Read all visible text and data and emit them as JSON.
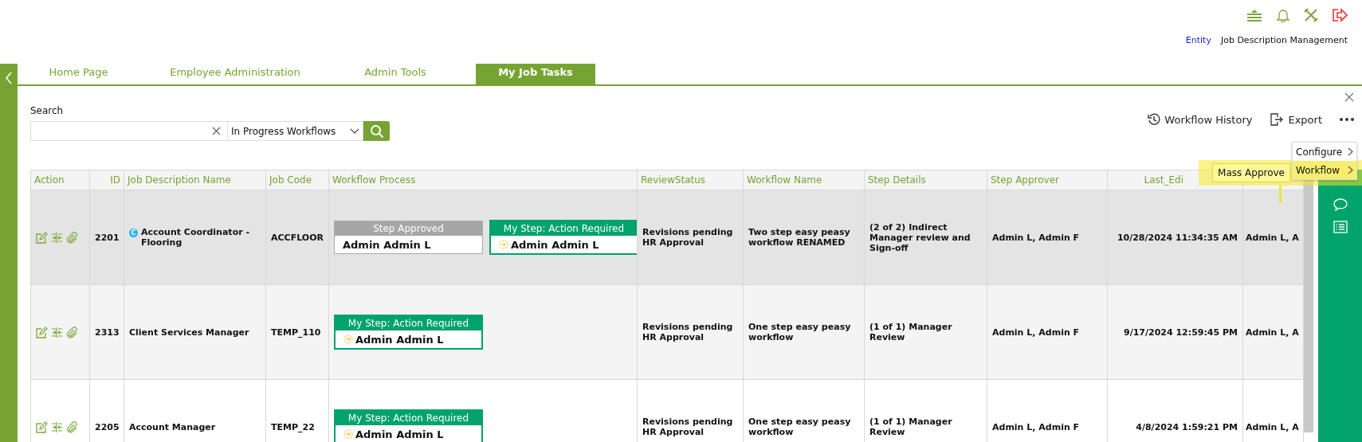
{
  "header": {
    "entity_link": "Entity",
    "module": "Job Description Management"
  },
  "tabs": [
    {
      "label": "Home Page",
      "selected": false
    },
    {
      "label": "Employee Administration",
      "selected": false
    },
    {
      "label": "Admin Tools",
      "selected": false
    },
    {
      "label": "My Job Tasks",
      "selected": true
    }
  ],
  "search": {
    "label": "Search",
    "filter": "In Progress Workflows"
  },
  "toolbar": {
    "history": "Workflow History",
    "export": "Export"
  },
  "menu": {
    "items": [
      {
        "label": "Configure",
        "highlighted": false
      },
      {
        "label": "Workflow",
        "highlighted": true
      }
    ],
    "submenu": "Mass Approve"
  },
  "table": {
    "columns": [
      "Action",
      "ID",
      "Job Description Name",
      "Job Code",
      "Workflow Process",
      "ReviewStatus",
      "Workflow Name",
      "Step Details",
      "Step Approver",
      "Last_Edi",
      ""
    ],
    "rows": [
      {
        "selected": true,
        "id": "2201",
        "badge": "C",
        "name": "Account Coordinator - Flooring",
        "code": "ACCFLOOR",
        "steps": [
          {
            "kind": "approved",
            "title": "Step Approved",
            "approver": "Admin Admin L"
          },
          {
            "kind": "pending",
            "title": "My Step: Action Required",
            "approver": "Admin Admin L"
          }
        ],
        "review_status": "Revisions pending HR Approval",
        "workflow_name": "Two step easy peasy workflow RENAMED",
        "step_details": "(2 of 2) Indirect Manager review and Sign-off",
        "step_approver": "Admin L, Admin F",
        "last_edited": "10/28/2024 11:34:35 AM",
        "column_11": "Admin L, A"
      },
      {
        "selected": false,
        "id": "2313",
        "name": "Client Services Manager",
        "code": "TEMP_110",
        "steps": [
          {
            "kind": "pending",
            "title": "My Step: Action Required",
            "approver": "Admin Admin L"
          }
        ],
        "review_status": "Revisions pending HR Approval",
        "workflow_name": "One step easy peasy workflow",
        "step_details": "(1 of 1) Manager Review",
        "step_approver": "Admin L, Admin F",
        "last_edited": "9/17/2024 12:59:45 PM",
        "column_11": "Admin L, A"
      },
      {
        "selected": false,
        "id": "2205",
        "name": "Account Manager",
        "code": "TEMP_22",
        "steps": [
          {
            "kind": "pending",
            "title": "My Step: Action Required",
            "approver": "Admin Admin L"
          }
        ],
        "review_status": "Revisions pending HR Approval",
        "workflow_name": "One step easy peasy workflow",
        "step_details": "(1 of 1) Manager Review",
        "step_approver": "Admin L, Admin F",
        "last_edited": "4/8/2024 1:59:21 PM",
        "column_11": "Admin L, A"
      }
    ]
  }
}
